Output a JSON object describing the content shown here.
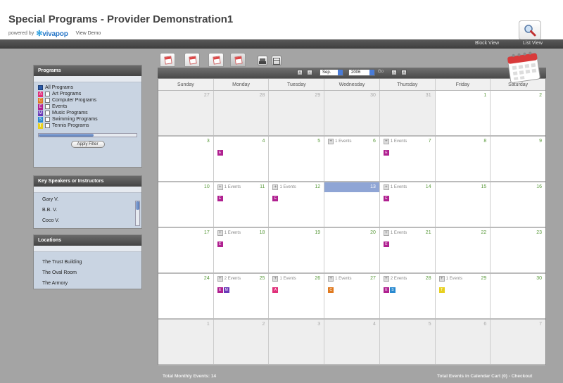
{
  "header": {
    "title": "Special Programs - Provider Demonstration1",
    "powered_by": "powered by",
    "logo": "vivapop",
    "view_demo": "View Demo"
  },
  "top_nav": {
    "block_view": "Block View",
    "list_view": "List View"
  },
  "programs_panel": {
    "title": "Programs",
    "all_label": "All Programs",
    "items": [
      {
        "letter": "A",
        "label": "Art Programs",
        "color": "#e0307a"
      },
      {
        "letter": "C",
        "label": "Computer Programs",
        "color": "#e07a20"
      },
      {
        "letter": "E",
        "label": "Events",
        "color": "#b02090"
      },
      {
        "letter": "M",
        "label": "Music Programs",
        "color": "#6a3ab8"
      },
      {
        "letter": "S",
        "label": "Swimming Programs",
        "color": "#2a8ad0"
      },
      {
        "letter": "T",
        "label": "Tennis Programs",
        "color": "#e8d020"
      }
    ],
    "apply": "Apply Filter"
  },
  "speakers_panel": {
    "title": "Key Speakers or Instructors",
    "items": [
      "Gary V.",
      "B.B. V.",
      "Coco V."
    ]
  },
  "locations_panel": {
    "title": "Locations",
    "items": [
      "The Trust Building",
      "The Oval Room",
      "The Armory"
    ]
  },
  "calendar_nav": {
    "month": "Sep.",
    "year": "2006",
    "go": "Go"
  },
  "days_of_week": [
    "Sunday",
    "Monday",
    "Tuesday",
    "Wednesday",
    "Thursday",
    "Friday",
    "Saturday"
  ],
  "weeks": [
    [
      {
        "n": "27",
        "other": true
      },
      {
        "n": "28",
        "other": true
      },
      {
        "n": "29",
        "other": true
      },
      {
        "n": "30",
        "other": true
      },
      {
        "n": "31",
        "other": true
      },
      {
        "n": "1"
      },
      {
        "n": "2"
      }
    ],
    [
      {
        "n": "3"
      },
      {
        "n": "4",
        "badges": [
          "E"
        ]
      },
      {
        "n": "5"
      },
      {
        "n": "6",
        "events": "1 Events"
      },
      {
        "n": "7",
        "events": "1 Events",
        "badges": [
          "E"
        ]
      },
      {
        "n": "8"
      },
      {
        "n": "9"
      }
    ],
    [
      {
        "n": "10"
      },
      {
        "n": "11",
        "events": "1 Events",
        "badges": [
          "E"
        ]
      },
      {
        "n": "12",
        "events": "1 Events",
        "badges": [
          "E"
        ]
      },
      {
        "n": "13",
        "today": true
      },
      {
        "n": "14",
        "events": "1 Events",
        "badges": [
          "E"
        ]
      },
      {
        "n": "15"
      },
      {
        "n": "16"
      }
    ],
    [
      {
        "n": "17"
      },
      {
        "n": "18",
        "events": "1 Events",
        "badges": [
          "E"
        ]
      },
      {
        "n": "19"
      },
      {
        "n": "20"
      },
      {
        "n": "21",
        "events": "1 Events",
        "badges": [
          "E"
        ]
      },
      {
        "n": "22"
      },
      {
        "n": "23"
      }
    ],
    [
      {
        "n": "24"
      },
      {
        "n": "25",
        "events": "2 Events",
        "badges": [
          "E",
          "M"
        ]
      },
      {
        "n": "26",
        "events": "1 Events",
        "badges": [
          "A"
        ]
      },
      {
        "n": "27",
        "events": "1 Events",
        "badges": [
          "C"
        ]
      },
      {
        "n": "28",
        "events": "2 Events",
        "badges": [
          "E",
          "S"
        ]
      },
      {
        "n": "29",
        "events": "1 Events",
        "badges": [
          "T"
        ]
      },
      {
        "n": "30"
      }
    ],
    [
      {
        "n": "1",
        "other": true
      },
      {
        "n": "2",
        "other": true
      },
      {
        "n": "3",
        "other": true
      },
      {
        "n": "4",
        "other": true
      },
      {
        "n": "5",
        "other": true
      },
      {
        "n": "6",
        "other": true
      },
      {
        "n": "7",
        "other": true
      }
    ]
  ],
  "footer": {
    "total": "Total Monthly Events: 14",
    "cart": "Total Events in Calendar Cart (0) - Checkout"
  }
}
